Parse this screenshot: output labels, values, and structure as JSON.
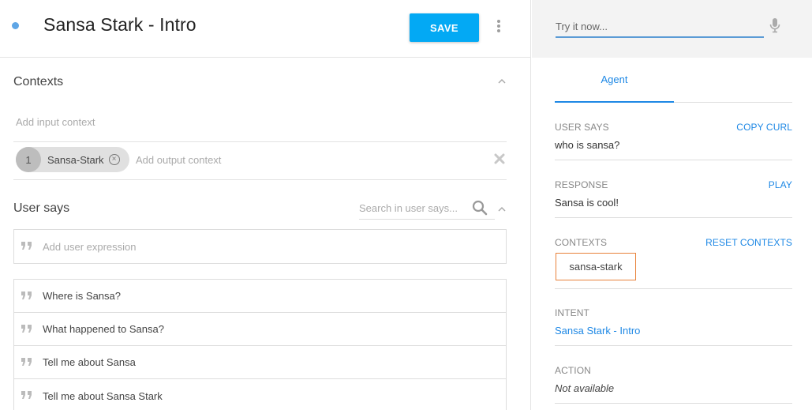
{
  "header": {
    "intent_title": "Sansa Stark - Intro",
    "save_label": "SAVE"
  },
  "contexts": {
    "section_title": "Contexts",
    "input_placeholder": "Add input context",
    "output_chip": {
      "number": "1",
      "label": "Sansa-Stark"
    },
    "output_placeholder": "Add output context"
  },
  "user_says": {
    "section_title": "User says",
    "search_placeholder": "Search in user says...",
    "add_placeholder": "Add user expression",
    "expressions": [
      "Where is Sansa?",
      "What happened to Sansa?",
      "Tell me about Sansa",
      "Tell me about Sansa Stark"
    ]
  },
  "console": {
    "try_placeholder": "Try it now...",
    "tab_label": "Agent",
    "user_says_label": "USER SAYS",
    "copy_curl_label": "COPY CURL",
    "user_says_value": "who is sansa?",
    "response_label": "RESPONSE",
    "play_label": "PLAY",
    "response_value": "Sansa is cool!",
    "contexts_label": "CONTEXTS",
    "reset_contexts_label": "RESET CONTEXTS",
    "context_value": "sansa-stark",
    "intent_label": "INTENT",
    "intent_value": "Sansa Stark - Intro",
    "action_label": "ACTION",
    "action_value": "Not available"
  },
  "colors": {
    "accent": "#03a9f4",
    "link": "#1e88e5",
    "context_border": "#e8823a",
    "status_dot": "#5fa6e6"
  }
}
